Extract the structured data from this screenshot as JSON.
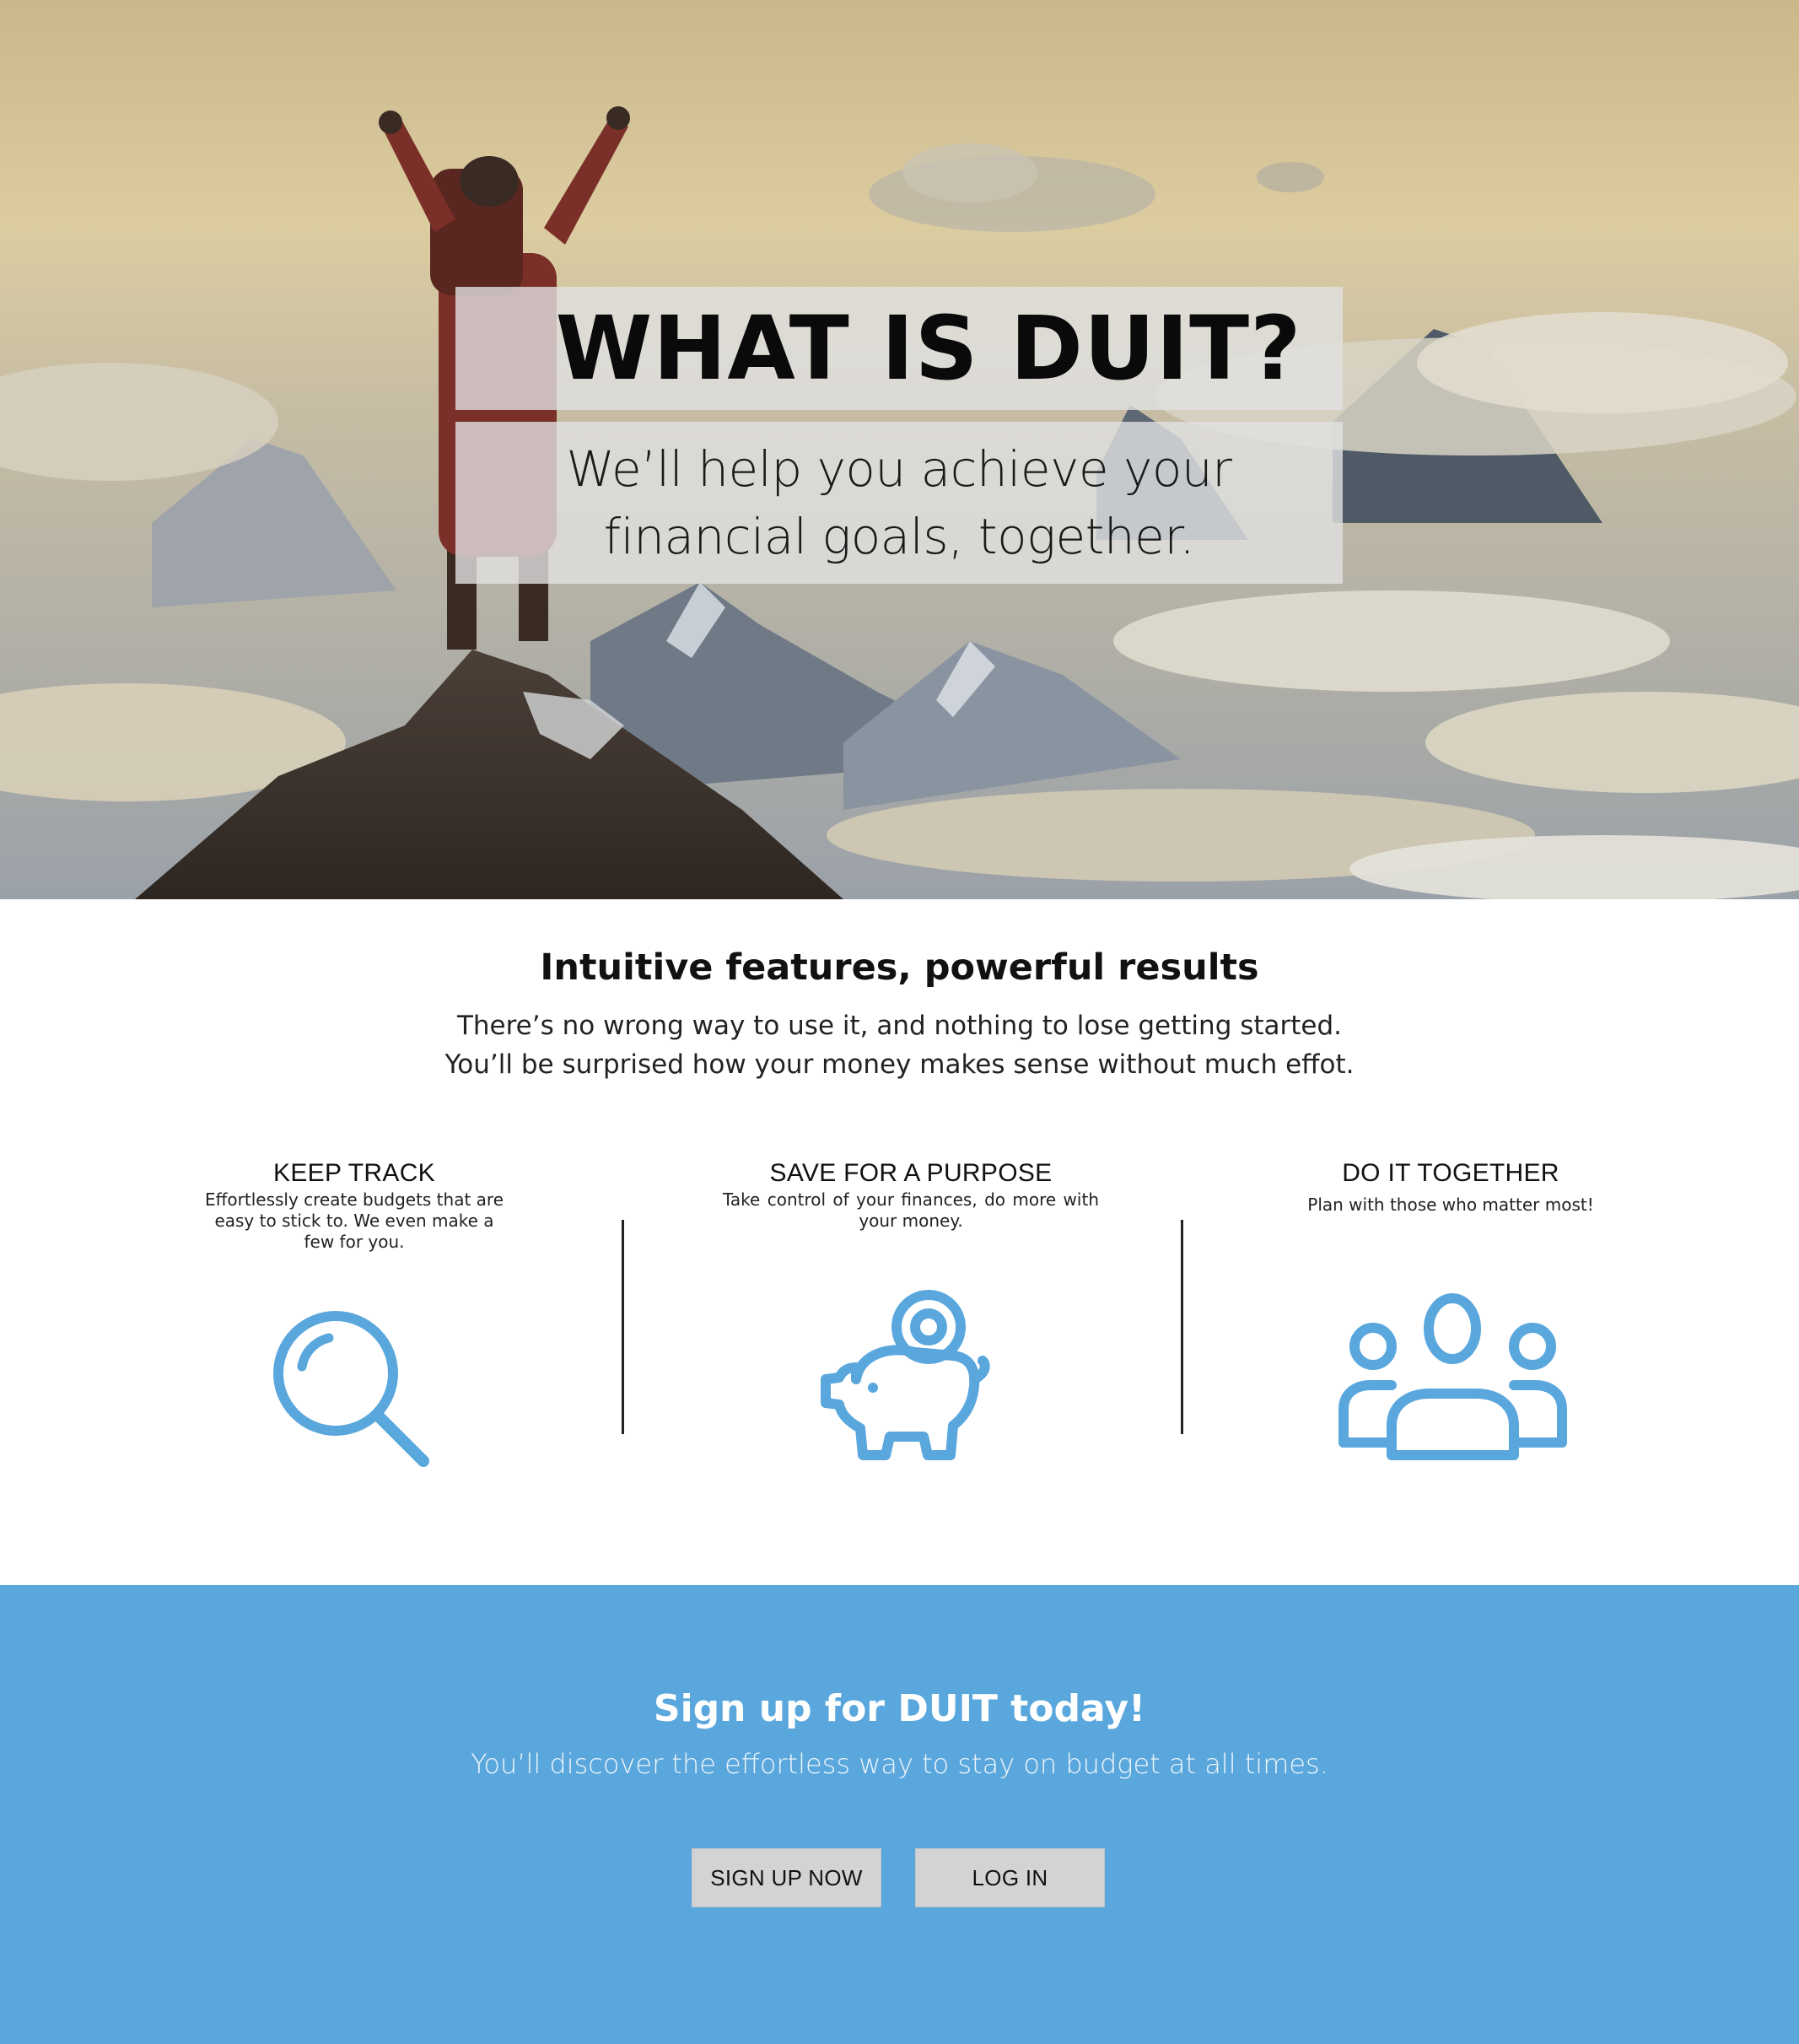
{
  "hero": {
    "title": "WHAT IS DUIT?",
    "subtitle": "We’ll help you achieve your financial goals, together."
  },
  "features": {
    "heading": "Intuitive features, powerful results",
    "description_line1": "There’s no wrong way to use it, and nothing to lose getting started.",
    "description_line2": "You’ll be surprised how your money makes sense without much effot.",
    "items": [
      {
        "title": "KEEP TRACK",
        "text": "Effortlessly create budgets that are easy to stick to. We even make a few for you.",
        "icon": "search-icon"
      },
      {
        "title": "SAVE FOR A PURPOSE",
        "text": "Take control of your finances, do more with your money.",
        "icon": "piggy-bank-icon"
      },
      {
        "title": "DO IT TOGETHER",
        "text": "Plan with those who matter most!",
        "icon": "group-icon"
      }
    ]
  },
  "cta": {
    "heading": "Sign up for DUIT today!",
    "text": "You’ll discover the effortless way to stay on budget at all times.",
    "signup_label": "SIGN UP NOW",
    "login_label": "LOG IN"
  },
  "colors": {
    "accent": "#5aa7dd",
    "button_bg": "#d3d3d5"
  }
}
